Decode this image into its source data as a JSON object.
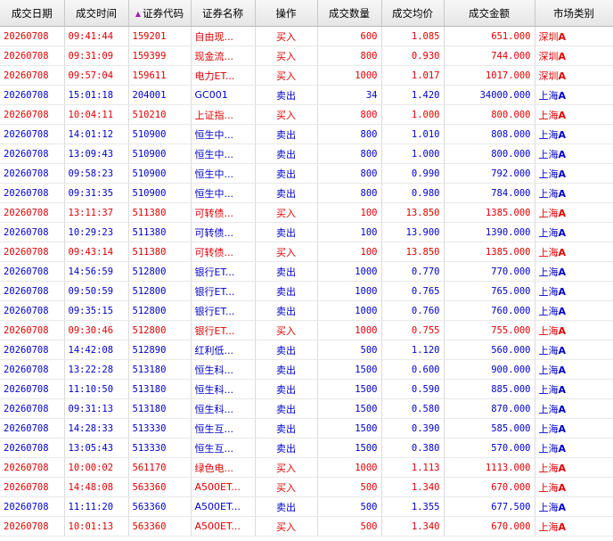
{
  "colors": {
    "buy": "#e00000",
    "sell": "#0000c8",
    "sort_indicator": "#9a22a8"
  },
  "headers": [
    "成交日期",
    "成交时间",
    "证券代码",
    "证券名称",
    "操作",
    "成交数量",
    "成交均价",
    "成交金额",
    "市场类别"
  ],
  "sort": {
    "column_index": 2,
    "icon": "triangle-up-icon"
  },
  "rows": [
    {
      "date": "20260708",
      "time": "09:41:44",
      "code": "159201",
      "name": "自由现...",
      "action": "买入",
      "qty": "600",
      "price": "1.085",
      "amount": "651.000",
      "market": "深圳",
      "market_suffix": "A",
      "side": "buy"
    },
    {
      "date": "20260708",
      "time": "09:31:09",
      "code": "159399",
      "name": "现金流...",
      "action": "买入",
      "qty": "800",
      "price": "0.930",
      "amount": "744.000",
      "market": "深圳",
      "market_suffix": "A",
      "side": "buy"
    },
    {
      "date": "20260708",
      "time": "09:57:04",
      "code": "159611",
      "name": "电力ET...",
      "action": "买入",
      "qty": "1000",
      "price": "1.017",
      "amount": "1017.000",
      "market": "深圳",
      "market_suffix": "A",
      "side": "buy"
    },
    {
      "date": "20260708",
      "time": "15:01:18",
      "code": "204001",
      "name": "GC001",
      "action": "卖出",
      "qty": "34",
      "price": "1.420",
      "amount": "34000.000",
      "market": "上海",
      "market_suffix": "A",
      "side": "sell"
    },
    {
      "date": "20260708",
      "time": "10:04:11",
      "code": "510210",
      "name": "上证指...",
      "action": "买入",
      "qty": "800",
      "price": "1.000",
      "amount": "800.000",
      "market": "上海",
      "market_suffix": "A",
      "side": "buy"
    },
    {
      "date": "20260708",
      "time": "14:01:12",
      "code": "510900",
      "name": "恒生中...",
      "action": "卖出",
      "qty": "800",
      "price": "1.010",
      "amount": "808.000",
      "market": "上海",
      "market_suffix": "A",
      "side": "sell"
    },
    {
      "date": "20260708",
      "time": "13:09:43",
      "code": "510900",
      "name": "恒生中...",
      "action": "卖出",
      "qty": "800",
      "price": "1.000",
      "amount": "800.000",
      "market": "上海",
      "market_suffix": "A",
      "side": "sell"
    },
    {
      "date": "20260708",
      "time": "09:58:23",
      "code": "510900",
      "name": "恒生中...",
      "action": "卖出",
      "qty": "800",
      "price": "0.990",
      "amount": "792.000",
      "market": "上海",
      "market_suffix": "A",
      "side": "sell"
    },
    {
      "date": "20260708",
      "time": "09:31:35",
      "code": "510900",
      "name": "恒生中...",
      "action": "卖出",
      "qty": "800",
      "price": "0.980",
      "amount": "784.000",
      "market": "上海",
      "market_suffix": "A",
      "side": "sell"
    },
    {
      "date": "20260708",
      "time": "13:11:37",
      "code": "511380",
      "name": "可转债...",
      "action": "买入",
      "qty": "100",
      "price": "13.850",
      "amount": "1385.000",
      "market": "上海",
      "market_suffix": "A",
      "side": "buy"
    },
    {
      "date": "20260708",
      "time": "10:29:23",
      "code": "511380",
      "name": "可转债...",
      "action": "卖出",
      "qty": "100",
      "price": "13.900",
      "amount": "1390.000",
      "market": "上海",
      "market_suffix": "A",
      "side": "sell"
    },
    {
      "date": "20260708",
      "time": "09:43:14",
      "code": "511380",
      "name": "可转债...",
      "action": "买入",
      "qty": "100",
      "price": "13.850",
      "amount": "1385.000",
      "market": "上海",
      "market_suffix": "A",
      "side": "buy"
    },
    {
      "date": "20260708",
      "time": "14:56:59",
      "code": "512800",
      "name": "银行ET...",
      "action": "卖出",
      "qty": "1000",
      "price": "0.770",
      "amount": "770.000",
      "market": "上海",
      "market_suffix": "A",
      "side": "sell"
    },
    {
      "date": "20260708",
      "time": "09:50:59",
      "code": "512800",
      "name": "银行ET...",
      "action": "卖出",
      "qty": "1000",
      "price": "0.765",
      "amount": "765.000",
      "market": "上海",
      "market_suffix": "A",
      "side": "sell"
    },
    {
      "date": "20260708",
      "time": "09:35:15",
      "code": "512800",
      "name": "银行ET...",
      "action": "卖出",
      "qty": "1000",
      "price": "0.760",
      "amount": "760.000",
      "market": "上海",
      "market_suffix": "A",
      "side": "sell"
    },
    {
      "date": "20260708",
      "time": "09:30:46",
      "code": "512800",
      "name": "银行ET...",
      "action": "买入",
      "qty": "1000",
      "price": "0.755",
      "amount": "755.000",
      "market": "上海",
      "market_suffix": "A",
      "side": "buy"
    },
    {
      "date": "20260708",
      "time": "14:42:08",
      "code": "512890",
      "name": "红利低...",
      "action": "卖出",
      "qty": "500",
      "price": "1.120",
      "amount": "560.000",
      "market": "上海",
      "market_suffix": "A",
      "side": "sell"
    },
    {
      "date": "20260708",
      "time": "13:22:28",
      "code": "513180",
      "name": "恒生科...",
      "action": "卖出",
      "qty": "1500",
      "price": "0.600",
      "amount": "900.000",
      "market": "上海",
      "market_suffix": "A",
      "side": "sell"
    },
    {
      "date": "20260708",
      "time": "11:10:50",
      "code": "513180",
      "name": "恒生科...",
      "action": "卖出",
      "qty": "1500",
      "price": "0.590",
      "amount": "885.000",
      "market": "上海",
      "market_suffix": "A",
      "side": "sell"
    },
    {
      "date": "20260708",
      "time": "09:31:13",
      "code": "513180",
      "name": "恒生科...",
      "action": "卖出",
      "qty": "1500",
      "price": "0.580",
      "amount": "870.000",
      "market": "上海",
      "market_suffix": "A",
      "side": "sell"
    },
    {
      "date": "20260708",
      "time": "14:28:33",
      "code": "513330",
      "name": "恒生互...",
      "action": "卖出",
      "qty": "1500",
      "price": "0.390",
      "amount": "585.000",
      "market": "上海",
      "market_suffix": "A",
      "side": "sell"
    },
    {
      "date": "20260708",
      "time": "13:05:43",
      "code": "513330",
      "name": "恒生互...",
      "action": "卖出",
      "qty": "1500",
      "price": "0.380",
      "amount": "570.000",
      "market": "上海",
      "market_suffix": "A",
      "side": "sell"
    },
    {
      "date": "20260708",
      "time": "10:00:02",
      "code": "561170",
      "name": "绿色电...",
      "action": "买入",
      "qty": "1000",
      "price": "1.113",
      "amount": "1113.000",
      "market": "上海",
      "market_suffix": "A",
      "side": "buy"
    },
    {
      "date": "20260708",
      "time": "14:48:08",
      "code": "563360",
      "name": "A500ET...",
      "action": "买入",
      "qty": "500",
      "price": "1.340",
      "amount": "670.000",
      "market": "上海",
      "market_suffix": "A",
      "side": "buy"
    },
    {
      "date": "20260708",
      "time": "11:11:20",
      "code": "563360",
      "name": "A500ET...",
      "action": "卖出",
      "qty": "500",
      "price": "1.355",
      "amount": "677.500",
      "market": "上海",
      "market_suffix": "A",
      "side": "sell"
    },
    {
      "date": "20260708",
      "time": "10:01:13",
      "code": "563360",
      "name": "A500ET...",
      "action": "买入",
      "qty": "500",
      "price": "1.340",
      "amount": "670.000",
      "market": "上海",
      "market_suffix": "A",
      "side": "buy"
    }
  ]
}
